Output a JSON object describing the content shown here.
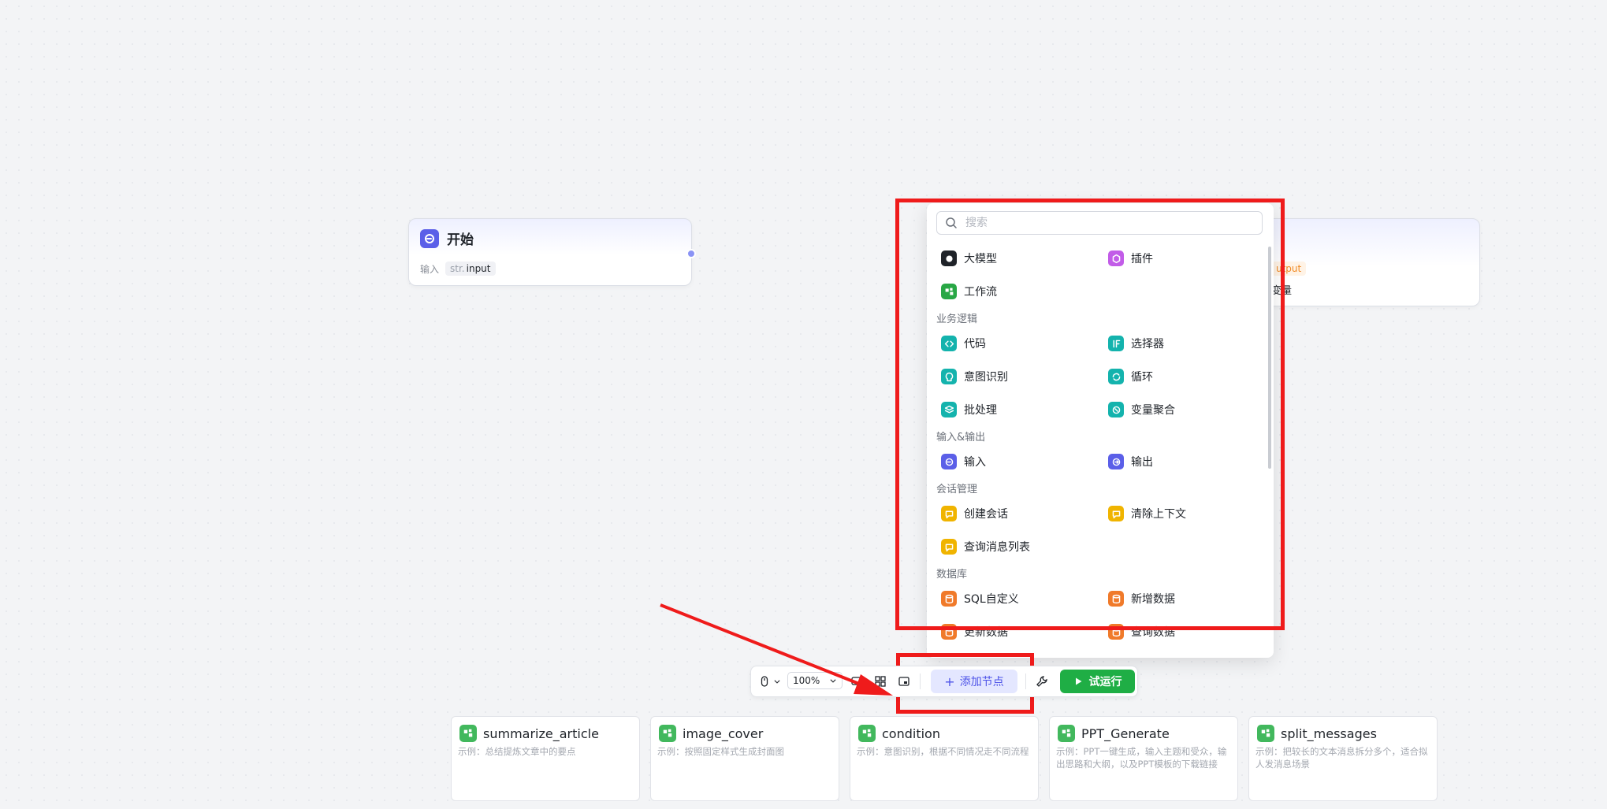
{
  "start_node": {
    "title": "开始",
    "input_label": "输入",
    "param_type": "str.",
    "param_name": "input"
  },
  "end_node": {
    "param_tag": "utput",
    "var_label": "变量"
  },
  "panel": {
    "search_placeholder": "搜索",
    "top_items": [
      {
        "label": "大模型",
        "icon": "llm-icon",
        "color": "#1f2329"
      },
      {
        "label": "插件",
        "icon": "plugin-icon",
        "color": "#c25ce8"
      },
      {
        "label": "工作流",
        "icon": "workflow-icon",
        "color": "#28a745"
      }
    ],
    "sections": [
      {
        "title": "业务逻辑",
        "items": [
          {
            "label": "代码",
            "icon": "code-icon",
            "color": "#14b3ad"
          },
          {
            "label": "选择器",
            "icon": "if-selector-icon",
            "color": "#14b3ad"
          },
          {
            "label": "意图识别",
            "icon": "intent-icon",
            "color": "#14b3ad"
          },
          {
            "label": "循环",
            "icon": "loop-icon",
            "color": "#14b3ad"
          },
          {
            "label": "批处理",
            "icon": "batch-icon",
            "color": "#14b3ad"
          },
          {
            "label": "变量聚合",
            "icon": "variable-aggregate-icon",
            "color": "#14b3ad"
          }
        ]
      },
      {
        "title": "输入&输出",
        "items": [
          {
            "label": "输入",
            "icon": "input-icon",
            "color": "#5b5fe8"
          },
          {
            "label": "输出",
            "icon": "output-icon",
            "color": "#5b5fe8"
          }
        ]
      },
      {
        "title": "会话管理",
        "items": [
          {
            "label": "创建会话",
            "icon": "create-session-icon",
            "color": "#f0b400"
          },
          {
            "label": "清除上下文",
            "icon": "clear-context-icon",
            "color": "#f0b400"
          },
          {
            "label": "查询消息列表",
            "icon": "query-messages-icon",
            "color": "#f0b400"
          }
        ]
      },
      {
        "title": "数据库",
        "items": [
          {
            "label": "SQL自定义",
            "icon": "sql-icon",
            "color": "#f07a2a"
          },
          {
            "label": "新增数据",
            "icon": "add-data-icon",
            "color": "#f07a2a"
          },
          {
            "label": "更新数据",
            "icon": "update-data-icon",
            "color": "#f07a2a"
          },
          {
            "label": "查询数据",
            "icon": "query-data-icon",
            "color": "#f07a2a"
          }
        ]
      }
    ]
  },
  "toolbar": {
    "zoom": "100%",
    "add_node_label": "添加节点",
    "run_label": "试运行"
  },
  "cards": [
    {
      "title": "summarize_article",
      "desc": "示例：总结提炼文章中的要点"
    },
    {
      "title": "image_cover",
      "desc": "示例：按照固定样式生成封面图"
    },
    {
      "title": "condition",
      "desc": "示例：意图识别，根据不同情况走不同流程"
    },
    {
      "title": "PPT_Generate",
      "desc": "示例：PPT一键生成，输入主题和受众，输出思路和大纲，以及PPT模板的下载链接"
    },
    {
      "title": "split_messages",
      "desc": "示例：把较长的文本消息拆分多个，适合拟人发消息场景"
    }
  ],
  "colors": {
    "accent": "#4d53e8",
    "run_green": "#1fae45",
    "highlight_red": "#ef1b1b"
  }
}
